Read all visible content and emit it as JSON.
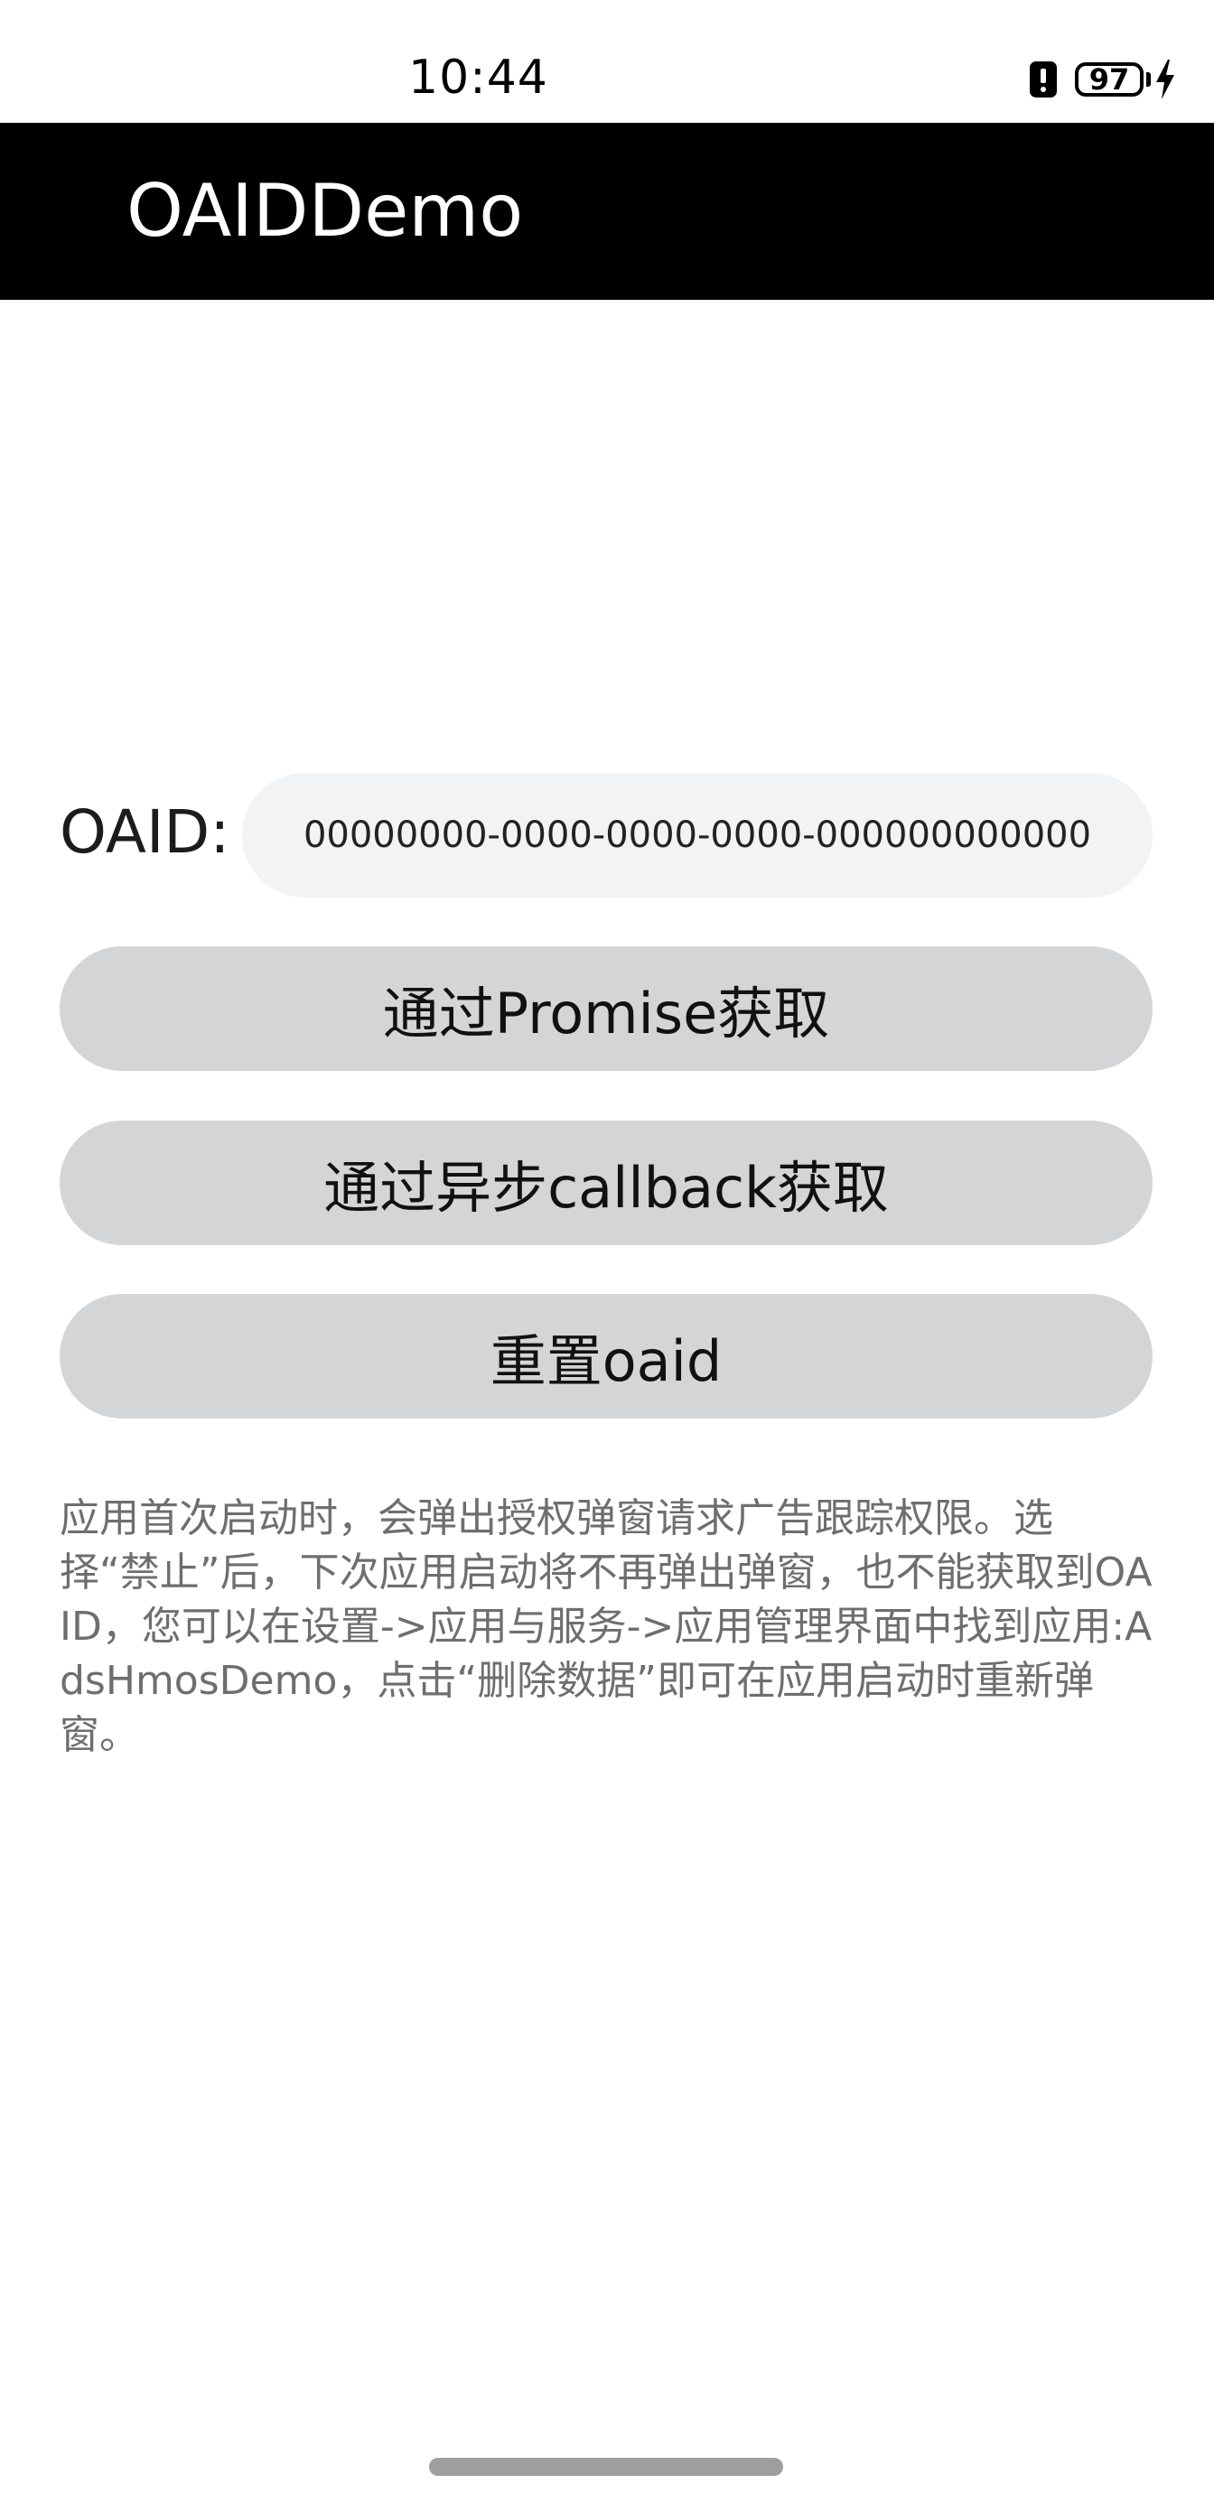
{
  "status_bar": {
    "time": "10:44",
    "battery_level": "97",
    "icons": [
      "alert-icon",
      "battery-icon",
      "charging-bolt-icon"
    ]
  },
  "app_bar": {
    "title": "OAIDDemo",
    "background": "#000000",
    "title_color": "#ffffff"
  },
  "oaid": {
    "label": "OAID:",
    "value": "00000000-0000-0000-0000-000000000000"
  },
  "buttons": {
    "promise_label": "通过Promise获取",
    "callback_label": "通过异步callback获取",
    "reset_label": "重置oaid"
  },
  "note": {
    "text": "应用首次启动时，会弹出授权弹窗请求广告跟踪权限。选择“禁止”后，下次应用启动将不再弹出弹窗，也不能获取到OAID，您可以在设置->应用与服务->应用管理界面中找到应用:AdsHmosDemo，点击“删除数据”即可在应用启动时重新弹窗。"
  },
  "colors": {
    "button_bg": "#d4d5d7",
    "field_bg": "#f1f3f5",
    "note_text": "#6e6e6e"
  }
}
